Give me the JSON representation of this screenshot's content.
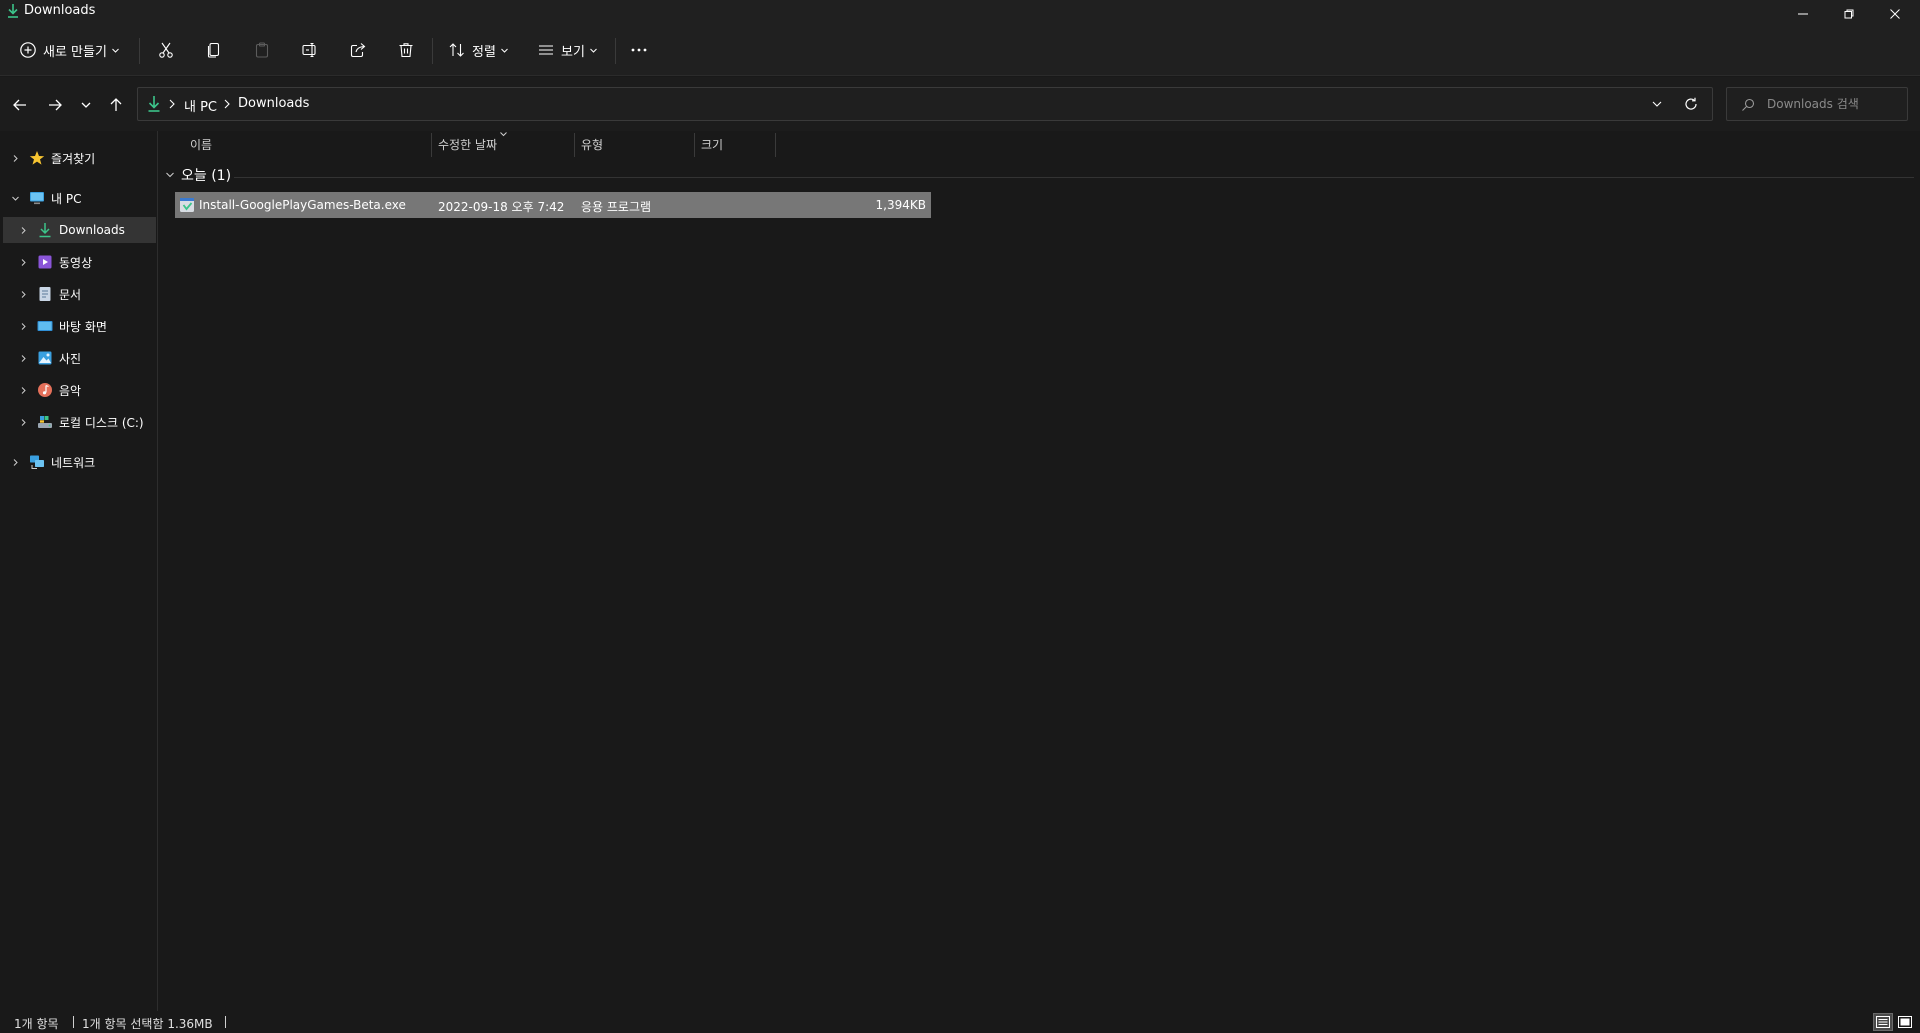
{
  "window": {
    "title": "Downloads"
  },
  "toolbar": {
    "new_label": "새로 만들기",
    "sort_label": "정렬",
    "view_label": "보기"
  },
  "address": {
    "crumbs": [
      "내 PC",
      "Downloads"
    ]
  },
  "search": {
    "placeholder": "Downloads 검색"
  },
  "sidebar": {
    "items": [
      {
        "label": "즐겨찾기"
      },
      {
        "label": "내 PC"
      },
      {
        "label": "Downloads"
      },
      {
        "label": "동영상"
      },
      {
        "label": "문서"
      },
      {
        "label": "바탕 화면"
      },
      {
        "label": "사진"
      },
      {
        "label": "음악"
      },
      {
        "label": "로컬 디스크 (C:)"
      },
      {
        "label": "네트워크"
      }
    ]
  },
  "columns": {
    "name": "이름",
    "modified": "수정한 날짜",
    "type": "유형",
    "size": "크기"
  },
  "group": {
    "label": "오늘 (1)"
  },
  "files": [
    {
      "name": "Install-GooglePlayGames-Beta.exe",
      "modified": "2022-09-18 오후 7:42",
      "type": "응용 프로그램",
      "size": "1,394KB"
    }
  ],
  "status": {
    "count": "1개 항목",
    "selected": "1개 항목 선택함 1.36MB"
  },
  "colors": {
    "accent_green": "#3cc48a",
    "selection": "#777777"
  }
}
